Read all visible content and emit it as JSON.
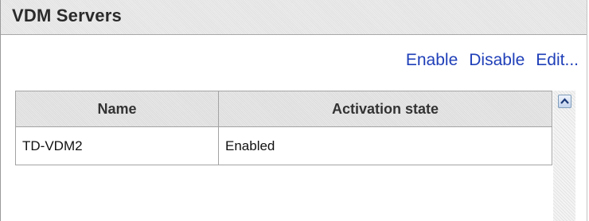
{
  "panel": {
    "title": "VDM Servers"
  },
  "actions": {
    "enable": "Enable",
    "disable": "Disable",
    "edit": "Edit..."
  },
  "table": {
    "columns": [
      "Name",
      "Activation state"
    ],
    "rows": [
      {
        "name": "TD-VDM2",
        "activation_state": "Enabled"
      }
    ]
  },
  "icons": {
    "scroll_up": "chevron-up-icon"
  },
  "colors": {
    "link": "#1f3fb8",
    "header_bg": "#e2e2e2"
  }
}
